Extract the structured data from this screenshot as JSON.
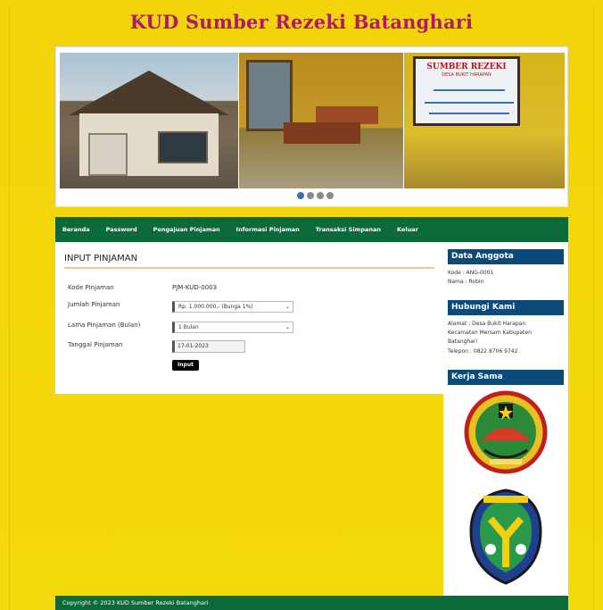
{
  "site": {
    "title": "KUD Sumber Rezeki Batanghari"
  },
  "slider": {
    "board_title": "SUMBER REZEKI",
    "board_sub": "DESA BUKIT HARAPAN",
    "dots": 4,
    "active_dot": 0
  },
  "nav": {
    "items": [
      "Beranda",
      "Password",
      "Pengajuan Pinjaman",
      "Informasi Pinjaman",
      "Transaksi Simpanan",
      "Keluar"
    ]
  },
  "form": {
    "heading": "INPUT PINJAMAN",
    "kode_label": "Kode Pinjaman",
    "kode_value": "PJM-KUD-0003",
    "jumlah_label": "Jumlah Pinjaman",
    "jumlah_value": "Rp. 1.000.000,- (Bunga 1%)",
    "lama_label": "Lama Pinjaman (Bulan)",
    "lama_value": "1 Bulan",
    "tanggal_label": "Tanggal Pinjaman",
    "tanggal_value": "17-01-2023",
    "submit_label": "Input"
  },
  "sidebar": {
    "anggota_heading": "Data Anggota",
    "anggota_kode": "Kode : ANG-0001",
    "anggota_nama": "Nama : Robin",
    "kontak_heading": "Hubungi Kami",
    "alamat_1": "Alamat : Desa Bukit Harapan",
    "alamat_2": "Kecamatan Mersam Kabupaten",
    "alamat_3": "Batanghari",
    "telepon": "Telepon : 0822 8706 9742",
    "kerjasama_heading": "Kerja Sama"
  },
  "footer": {
    "text": "Copyright © 2023 KUD Sumber Rezeki Batanghari"
  },
  "colors": {
    "background": "#f3d70b",
    "title": "#b0196a",
    "nav": "#0c6a3a",
    "sidebar_heading": "#0c4a7a"
  }
}
